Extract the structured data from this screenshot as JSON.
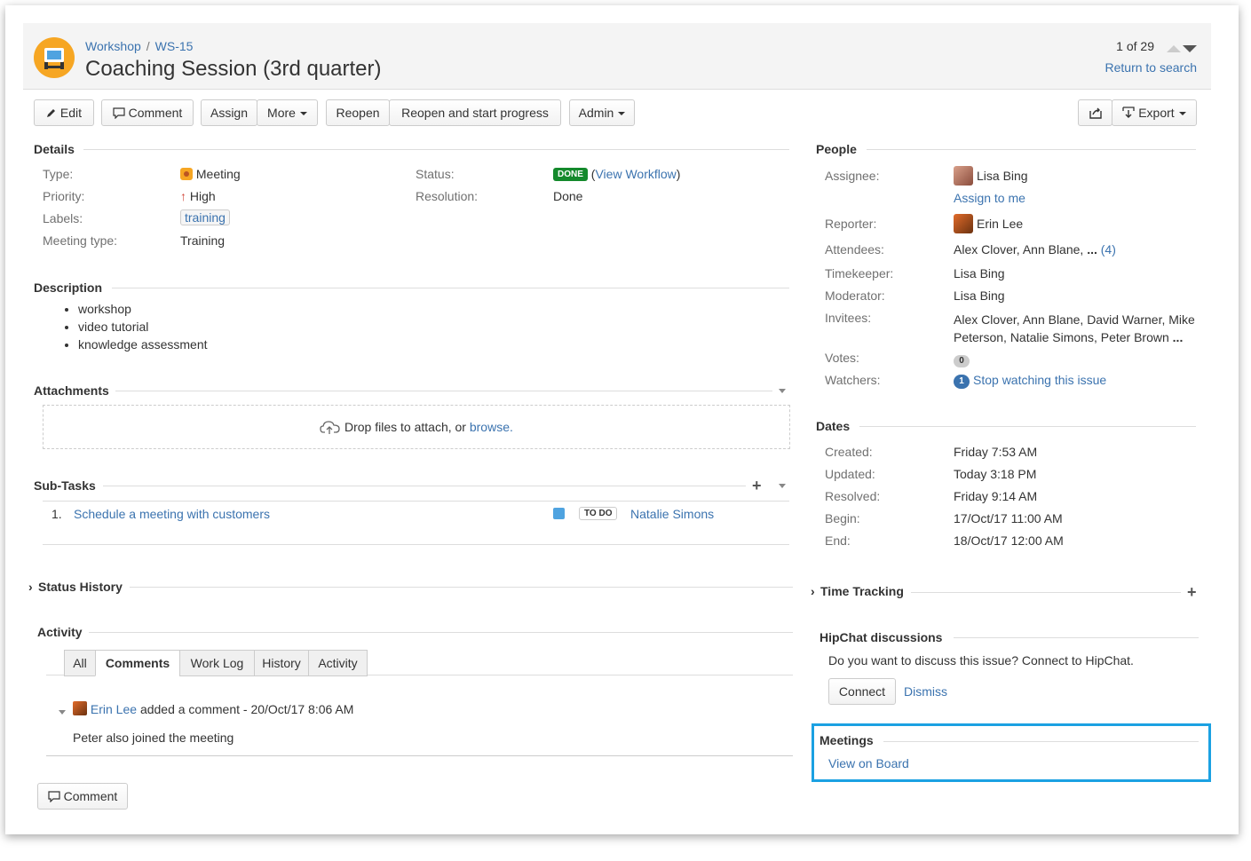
{
  "header": {
    "breadcrumb_project": "Workshop",
    "breadcrumb_sep": "/",
    "breadcrumb_issue": "WS-15",
    "title": "Coaching Session (3rd quarter)",
    "pager": "1 of 29",
    "return_link": "Return to search"
  },
  "toolbar": {
    "edit": "Edit",
    "comment": "Comment",
    "assign": "Assign",
    "more": "More",
    "reopen": "Reopen",
    "reopen_progress": "Reopen and start progress",
    "admin": "Admin",
    "export": "Export"
  },
  "details": {
    "heading": "Details",
    "type_label": "Type:",
    "type_value": "Meeting",
    "priority_label": "Priority:",
    "priority_value": "High",
    "labels_label": "Labels:",
    "labels_value": "training",
    "meeting_type_label": "Meeting type:",
    "meeting_type_value": "Training",
    "status_label": "Status:",
    "status_value": "DONE",
    "view_workflow": "View Workflow",
    "resolution_label": "Resolution:",
    "resolution_value": "Done"
  },
  "description": {
    "heading": "Description",
    "items": [
      "workshop",
      "video tutorial",
      "knowledge assessment"
    ]
  },
  "attachments": {
    "heading": "Attachments",
    "drop_text": "Drop files to attach, or",
    "browse": "browse."
  },
  "subtasks": {
    "heading": "Sub-Tasks",
    "rows": [
      {
        "num": "1.",
        "summary": "Schedule a meeting with customers",
        "status": "TO DO",
        "assignee": "Natalie Simons"
      }
    ]
  },
  "status_history": {
    "heading": "Status History"
  },
  "activity": {
    "heading": "Activity",
    "tabs": [
      "All",
      "Comments",
      "Work Log",
      "History",
      "Activity"
    ],
    "active_tab": "Comments",
    "comment_author": "Erin Lee",
    "comment_meta": "added a comment - 20/Oct/17 8:06 AM",
    "comment_body": "Peter also joined the meeting",
    "comment_button": "Comment"
  },
  "people": {
    "heading": "People",
    "assignee_label": "Assignee:",
    "assignee_value": "Lisa Bing",
    "assign_to_me": "Assign to me",
    "reporter_label": "Reporter:",
    "reporter_value": "Erin Lee",
    "attendees_label": "Attendees:",
    "attendees_value": "Alex Clover, Ann Blane,",
    "attendees_more": "...",
    "attendees_count": "(4)",
    "timekeeper_label": "Timekeeper:",
    "timekeeper_value": "Lisa Bing",
    "moderator_label": "Moderator:",
    "moderator_value": "Lisa Bing",
    "invitees_label": "Invitees:",
    "invitees_line1": "Alex Clover, Ann Blane, David Warner, Mike",
    "invitees_line2": "Peterson, Natalie Simons, Peter Brown",
    "invitees_more": "...",
    "votes_label": "Votes:",
    "votes_value": "0",
    "watchers_label": "Watchers:",
    "watchers_count": "1",
    "watchers_link": "Stop watching this issue"
  },
  "dates": {
    "heading": "Dates",
    "created_label": "Created:",
    "created_value": "Friday 7:53 AM",
    "updated_label": "Updated:",
    "updated_value": "Today 3:18 PM",
    "resolved_label": "Resolved:",
    "resolved_value": "Friday 9:14 AM",
    "begin_label": "Begin:",
    "begin_value": "17/Oct/17 11:00 AM",
    "end_label": "End:",
    "end_value": "18/Oct/17 12:00 AM"
  },
  "time_tracking": {
    "heading": "Time Tracking"
  },
  "hipchat": {
    "heading": "HipChat discussions",
    "text": "Do you want to discuss this issue? Connect to HipChat.",
    "connect": "Connect",
    "dismiss": "Dismiss"
  },
  "meetings": {
    "heading": "Meetings",
    "view_on_board": "View on Board"
  },
  "colors": {
    "link": "#3b73af",
    "done_green": "#14892c",
    "highlight_blue": "#1ba1e2",
    "project_orange": "#f6a623"
  }
}
